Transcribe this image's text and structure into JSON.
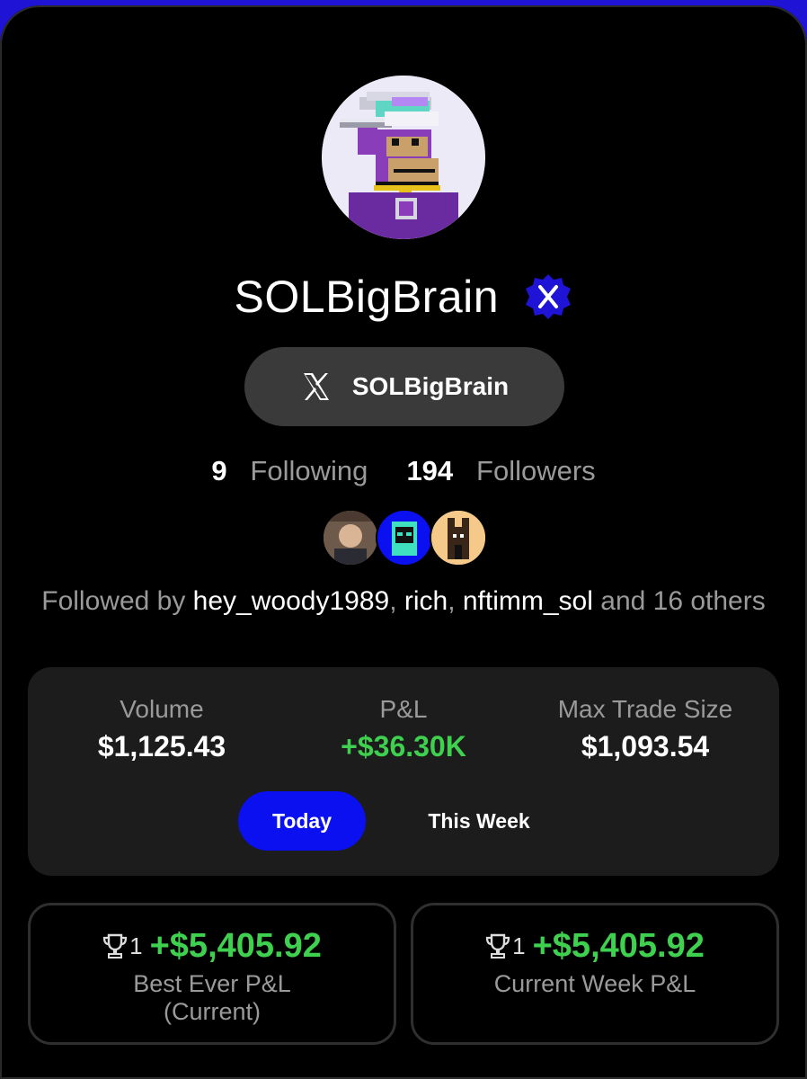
{
  "profile": {
    "display_name": "SOLBigBrain",
    "verified_icon": "x-verified-badge-icon",
    "handle": "SOLBigBrain",
    "avatar": "pixel-ape-avatar"
  },
  "counts": {
    "following_count": "9",
    "following_label": "Following",
    "followers_count": "194",
    "followers_label": "Followers"
  },
  "followed_by": {
    "prefix": "Followed by ",
    "names": [
      "hey_woody1989",
      "rich",
      "nftimm_sol"
    ],
    "suffix": " and 16 others"
  },
  "stats": [
    {
      "label": "Volume",
      "value": "$1,125.43",
      "color": "#ffffff"
    },
    {
      "label": "P&L",
      "value": "+$36.30K",
      "color": "#3fd04f"
    },
    {
      "label": "Max Trade Size",
      "value": "$1,093.54",
      "color": "#ffffff"
    }
  ],
  "tabs": {
    "active": "Today",
    "inactive": "This Week"
  },
  "cards": [
    {
      "rank": "1",
      "amount": "+$5,405.92",
      "subtitle_line1": "Best Ever P&L",
      "subtitle_line2": "(Current)"
    },
    {
      "rank": "1",
      "amount": "+$5,405.92",
      "subtitle_line1": "Current Week P&L",
      "subtitle_line2": ""
    }
  ],
  "colors": {
    "accent_blue": "#0b10f0",
    "positive_green": "#3fd04f",
    "background": "#000000",
    "card_bg": "#1c1c1c"
  }
}
